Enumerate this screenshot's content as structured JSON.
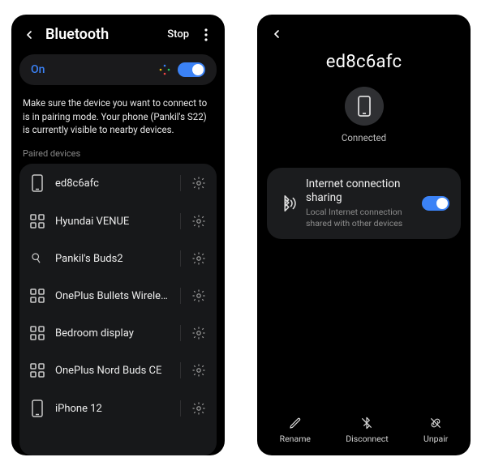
{
  "left": {
    "header": {
      "title": "Bluetooth",
      "stop_label": "Stop"
    },
    "toggle": {
      "on_label": "On"
    },
    "help_text": "Make sure the device you want to connect to is in pairing mode. Your phone (Pankil's S22) is currently visible to nearby devices.",
    "section_label": "Paired devices",
    "devices": [
      {
        "name": "ed8c6afc",
        "icon": "phone"
      },
      {
        "name": "Hyundai VENUE",
        "icon": "grid"
      },
      {
        "name": "Pankil's Buds2",
        "icon": "earbud"
      },
      {
        "name": "OnePlus Bullets Wireless Z",
        "icon": "grid"
      },
      {
        "name": "Bedroom display",
        "icon": "grid"
      },
      {
        "name": "OnePlus Nord Buds CE",
        "icon": "grid"
      },
      {
        "name": "iPhone 12",
        "icon": "phone"
      }
    ]
  },
  "right": {
    "title": "ed8c6afc",
    "status": "Connected",
    "sharing": {
      "title": "Internet connection sharing",
      "subtitle": "Local Internet connection shared with other devices"
    },
    "actions": {
      "rename": "Rename",
      "disconnect": "Disconnect",
      "unpair": "Unpair"
    }
  }
}
